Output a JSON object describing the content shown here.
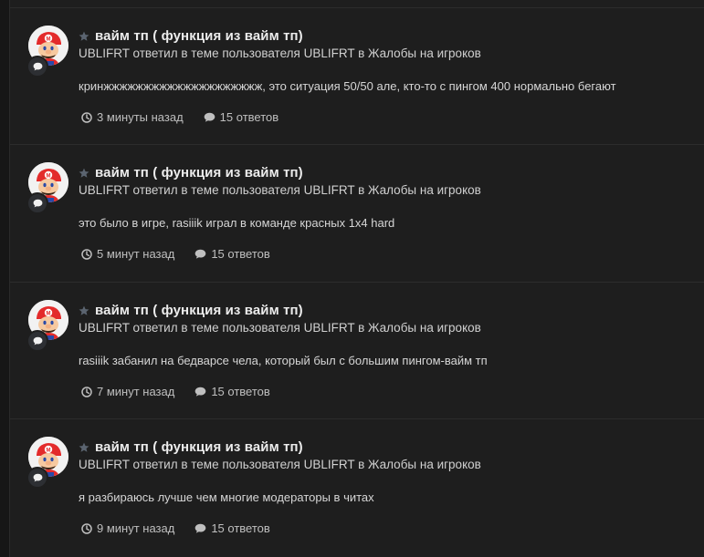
{
  "items": [
    {
      "title": "вайм тп ( функция из вайм тп)",
      "subline": "UBLIFRT ответил в теме пользователя UBLIFRT в Жалобы на игроков",
      "snippet": "кринжжжжжжжжжжжжжжжжжжжж, это ситуация 50/50 але, кто-то с пингом 400 нормально бегают",
      "time": "3 минуты назад",
      "replies": "15 ответов"
    },
    {
      "title": "вайм тп ( функция из вайм тп)",
      "subline": "UBLIFRT ответил в теме пользователя UBLIFRT в Жалобы на игроков",
      "snippet": "это было в игре, rasiiik играл в команде красных 1x4 hard",
      "time": "5 минут назад",
      "replies": "15 ответов"
    },
    {
      "title": "вайм тп ( функция из вайм тп)",
      "subline": "UBLIFRT ответил в теме пользователя UBLIFRT в Жалобы на игроков",
      "snippet": "rasiiik забанил на бедварсе чела, который был с большим пингом-вайм тп",
      "time": "7 минут назад",
      "replies": "15 ответов"
    },
    {
      "title": "вайм тп ( функция из вайм тп)",
      "subline": "UBLIFRT ответил в теме пользователя UBLIFRT в Жалобы на игроков",
      "snippet": "я разбираюсь лучше чем многие модераторы в читах",
      "time": "9 минут назад",
      "replies": "15 ответов"
    }
  ],
  "icons": {
    "star": "star-icon",
    "badge": "comment-icon",
    "time": "clock-icon",
    "replies": "comment-icon"
  },
  "colors": {
    "background": "#1e1e1e",
    "text": "#ececec",
    "muted": "#bfbfbf",
    "avatar_red": "#e32b2b"
  }
}
